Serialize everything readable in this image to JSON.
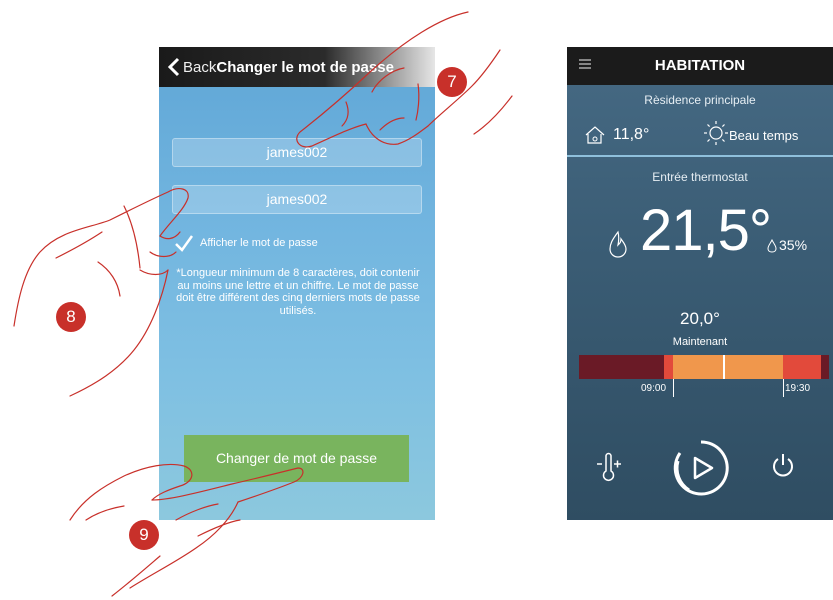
{
  "password_screen": {
    "back_label": "Back",
    "title": "Changer le mot de passe",
    "password_value": "james002",
    "confirm_value": "james002",
    "show_password_label": "Afficher le mot de passe",
    "show_password_checked": true,
    "rules_text": "*Longueur minimum de 8 caractères, doit contenir au moins une lettre et un chiffre. Le mot de passe doit être différent des cinq derniers mots de passe utilisés.",
    "change_button_label": "Changer de mot de passe",
    "button_color": "#79b45e"
  },
  "thermostat_screen": {
    "title": "HABITATION",
    "residence": "Rèsidence principale",
    "outside_temp": "11,8°",
    "weather": "Beau temps",
    "thermostat_label": "Entrée thermostat",
    "room_temp": "21,5°",
    "humidity": "35%",
    "setpoint": "20,0°",
    "now_label": "Maintenant",
    "time_start": "09:00",
    "time_end": "19:30",
    "icons": [
      "menu-icon",
      "house-icon",
      "sun-icon",
      "flame-icon",
      "drop-icon",
      "thermometer-plus-icon",
      "play-icon",
      "power-icon"
    ]
  },
  "steps": [
    "7",
    "8",
    "9"
  ],
  "colors": {
    "badge": "#c8302a",
    "timeline_dark": "#6a1a26",
    "timeline_orange": "#f0974c",
    "timeline_red": "#e24a3b"
  }
}
